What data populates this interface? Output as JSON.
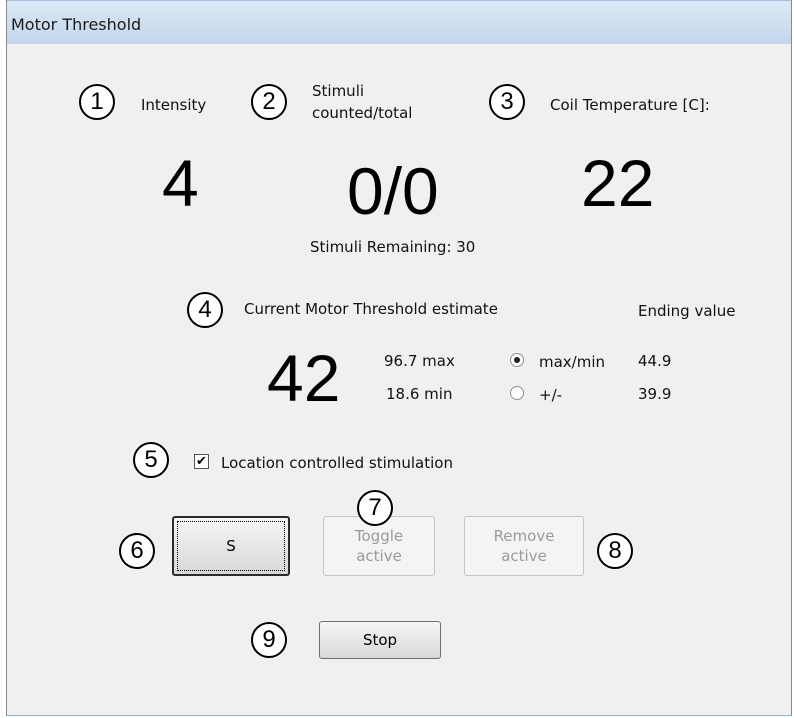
{
  "window": {
    "title": "Motor Threshold"
  },
  "markers": [
    "1",
    "2",
    "3",
    "4",
    "5",
    "6",
    "7",
    "8",
    "9"
  ],
  "intensity": {
    "label": "Intensity",
    "value": "4"
  },
  "stimuli": {
    "label_line1": "Stimuli",
    "label_line2": "counted/total",
    "value": "0/0",
    "remaining_text": "Stimuli Remaining: 30"
  },
  "coil": {
    "label": "Coil Temperature [C]:",
    "value": "22"
  },
  "threshold": {
    "label": "Current Motor Threshold estimate",
    "value": "42",
    "max_text": "96.7 max",
    "min_text": "18.6 min",
    "ending_header": "Ending value",
    "options": [
      {
        "label": "max/min",
        "checked": true,
        "ending": "44.9"
      },
      {
        "label": "+/-",
        "checked": false,
        "ending": "39.9"
      }
    ]
  },
  "location": {
    "label": "Location controlled stimulation",
    "checked": true,
    "check_glyph": "✔"
  },
  "buttons": {
    "s_label": "S",
    "toggle_line1": "Toggle",
    "toggle_line2": "active",
    "remove_line1": "Remove",
    "remove_line2": "active",
    "stop_label": "Stop"
  }
}
